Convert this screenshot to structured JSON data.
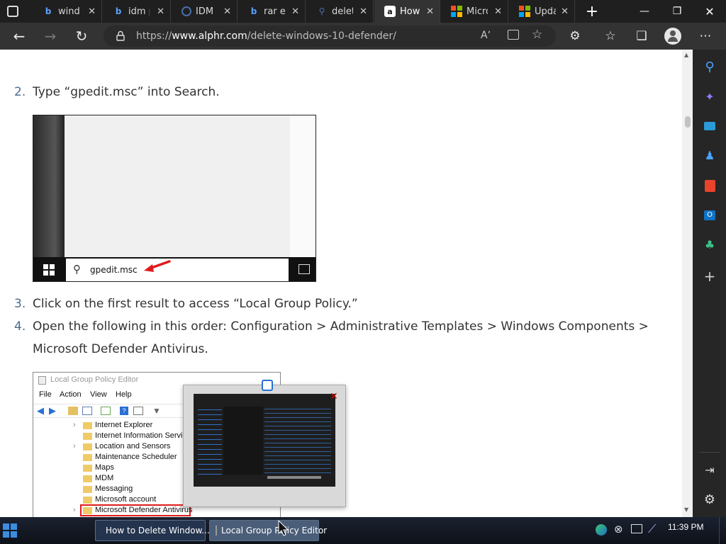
{
  "tabs": [
    {
      "label": "windo",
      "icon": "bing-icon",
      "active": false
    },
    {
      "label": "idm p",
      "icon": "bing-icon",
      "active": false
    },
    {
      "label": "IDM C",
      "icon": "edge-loading-icon",
      "active": false
    },
    {
      "label": "rar ex",
      "icon": "bing-icon",
      "active": false
    },
    {
      "label": "delet",
      "icon": "search-icon",
      "active": false
    },
    {
      "label": "How",
      "icon": "alphr-icon",
      "active": true
    },
    {
      "label": "Micro",
      "icon": "microsoft-icon",
      "active": false
    },
    {
      "label": "Upda",
      "icon": "microsoft-icon",
      "active": false
    }
  ],
  "address": {
    "scheme": "https://",
    "host": "www.alphr.com",
    "path": "/delete-windows-10-defender/"
  },
  "steps": [
    {
      "num": "2.",
      "text": "Type “gpedit.msc” into Search."
    },
    {
      "num": "3.",
      "text": "Click on the first result to access “Local Group Policy.”"
    },
    {
      "num": "4.",
      "text": "Open the following in this order: Configuration > Administrative Templates > Windows Components >"
    },
    {
      "num": "",
      "text": "Microsoft Defender Antivirus."
    }
  ],
  "search_shot": {
    "query": "gpedit.msc"
  },
  "gpedit": {
    "title": "Local Group Policy Editor",
    "menu": [
      "File",
      "Action",
      "View",
      "Help"
    ],
    "tree": [
      "Internet Explorer",
      "Internet Information Services",
      "Location and Sensors",
      "Maintenance Scheduler",
      "Maps",
      "MDM",
      "Messaging",
      "Microsoft account",
      "Microsoft Defender Antivirus"
    ]
  },
  "taskbar": {
    "tasks": [
      "How to Delete Window...",
      "Local Group Policy Editor"
    ],
    "clock": "11:39 PM"
  }
}
